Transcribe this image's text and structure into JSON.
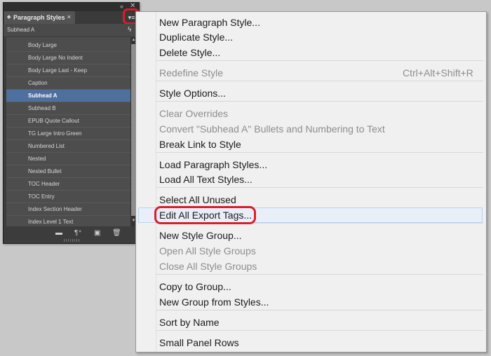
{
  "panel": {
    "tab_title": "Paragraph Styles",
    "tab_close": "✕",
    "current_style": "Subhead A",
    "window_controls": {
      "collapse": "«",
      "close": "✕"
    },
    "menu_button_icon": "▾≡",
    "styles": [
      {
        "label": "Body Large",
        "selected": false
      },
      {
        "label": "Body Large No Indent",
        "selected": false
      },
      {
        "label": "Body Large Last - Keep",
        "selected": false
      },
      {
        "label": "Caption",
        "selected": false
      },
      {
        "label": "Subhead A",
        "selected": true
      },
      {
        "label": "Subhead B",
        "selected": false
      },
      {
        "label": "EPUB Quote Callout",
        "selected": false
      },
      {
        "label": "TG Large Intro Green",
        "selected": false
      },
      {
        "label": "Numbered List",
        "selected": false
      },
      {
        "label": "Nested",
        "selected": false
      },
      {
        "label": "Nested Bullet",
        "selected": false
      },
      {
        "label": "TOC Header",
        "selected": false
      },
      {
        "label": "TOC Entry",
        "selected": false
      },
      {
        "label": "Index Section Header",
        "selected": false
      },
      {
        "label": "Index Level 1 Text",
        "selected": false
      }
    ],
    "footer_icons": [
      "folder-icon",
      "clear-overrides-icon",
      "new-style-icon",
      "trash-icon"
    ]
  },
  "menu": {
    "items": [
      {
        "label": "New Paragraph Style...",
        "enabled": true
      },
      {
        "label": "Duplicate Style...",
        "enabled": true
      },
      {
        "label": "Delete Style...",
        "enabled": true
      },
      {
        "label": "Redefine Style",
        "enabled": false,
        "shortcut": "Ctrl+Alt+Shift+R"
      },
      {
        "label": "Style Options...",
        "enabled": true
      },
      {
        "label": "Clear Overrides",
        "enabled": false
      },
      {
        "label": "Convert \"Subhead A\" Bullets and Numbering to Text",
        "enabled": false
      },
      {
        "label": "Break Link to Style",
        "enabled": true
      },
      {
        "label": "Load Paragraph Styles...",
        "enabled": true
      },
      {
        "label": "Load All Text Styles...",
        "enabled": true
      },
      {
        "label": "Select All Unused",
        "enabled": true
      },
      {
        "label": "Edit All Export Tags...",
        "enabled": true,
        "highlighted": true
      },
      {
        "label": "New Style Group...",
        "enabled": true
      },
      {
        "label": "Open All Style Groups",
        "enabled": false
      },
      {
        "label": "Close All Style Groups",
        "enabled": false
      },
      {
        "label": "Copy to Group...",
        "enabled": true
      },
      {
        "label": "New Group from Styles...",
        "enabled": true
      },
      {
        "label": "Sort by Name",
        "enabled": true
      },
      {
        "label": "Small Panel Rows",
        "enabled": true
      }
    ]
  },
  "colors": {
    "highlight_ring": "#d91f2a",
    "selected_row": "#4f6f9f",
    "menu_background": "#f0f0f0",
    "disabled_text": "#8d8d8d"
  }
}
